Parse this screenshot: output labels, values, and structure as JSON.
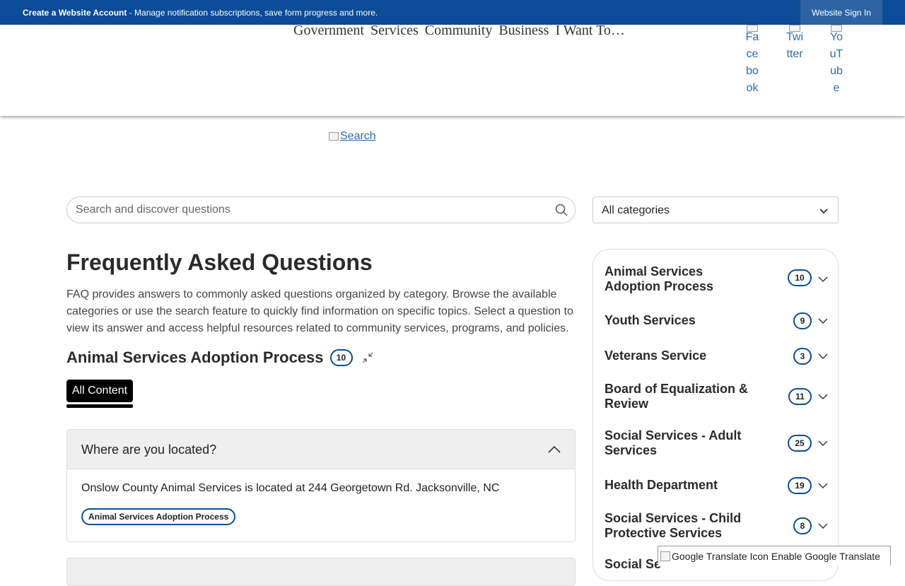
{
  "topbar": {
    "create_account": "Create a Website Account",
    "message": " - Manage notification subscriptions, save form progress and more.",
    "sign_in": "Website Sign In"
  },
  "nav": {
    "items": [
      "Government",
      "Services",
      "Community",
      "Business",
      "I Want To…"
    ]
  },
  "social": {
    "facebook": [
      "Fa",
      "ce",
      "bo",
      "ok"
    ],
    "twitter": [
      "Twi",
      "tter"
    ],
    "youtube": [
      "Yo",
      "uT",
      "ub",
      "e"
    ]
  },
  "search_link": "Search",
  "faq_search": {
    "placeholder": "Search and discover questions"
  },
  "category_select": {
    "value": "All categories"
  },
  "page": {
    "title": "Frequently Asked Questions",
    "intro": "FAQ provides answers to commonly asked questions organized by category. Browse the available categories or use the search feature to quickly find information on specific topics. Select a question to view its answer and access helpful resources related to community services, programs, and policies."
  },
  "section": {
    "name": "Animal Services Adoption Process",
    "count": "10",
    "tab": "All Content"
  },
  "question": {
    "text": "Where are you located?",
    "answer": "Onslow County Animal Services is located at 244 Georgetown Rd. Jacksonville, NC",
    "tag": "Animal Services Adoption Process"
  },
  "categories": [
    {
      "name": "Animal Services Adoption Process",
      "count": "10"
    },
    {
      "name": "Youth Services",
      "count": "9"
    },
    {
      "name": "Veterans Service",
      "count": "3"
    },
    {
      "name": "Board of Equalization & Review",
      "count": "11"
    },
    {
      "name": "Social Services - Adult Services",
      "count": "25"
    },
    {
      "name": "Health Department",
      "count": "19"
    },
    {
      "name": "Social Services - Child Protective Services",
      "count": "8"
    },
    {
      "name": "Social Se",
      "count": ""
    }
  ],
  "translate": "Google Translate Icon Enable Google Translate",
  "colors": {
    "brand_blue": "#0b4c97",
    "signin_bg": "#2d63a3"
  }
}
